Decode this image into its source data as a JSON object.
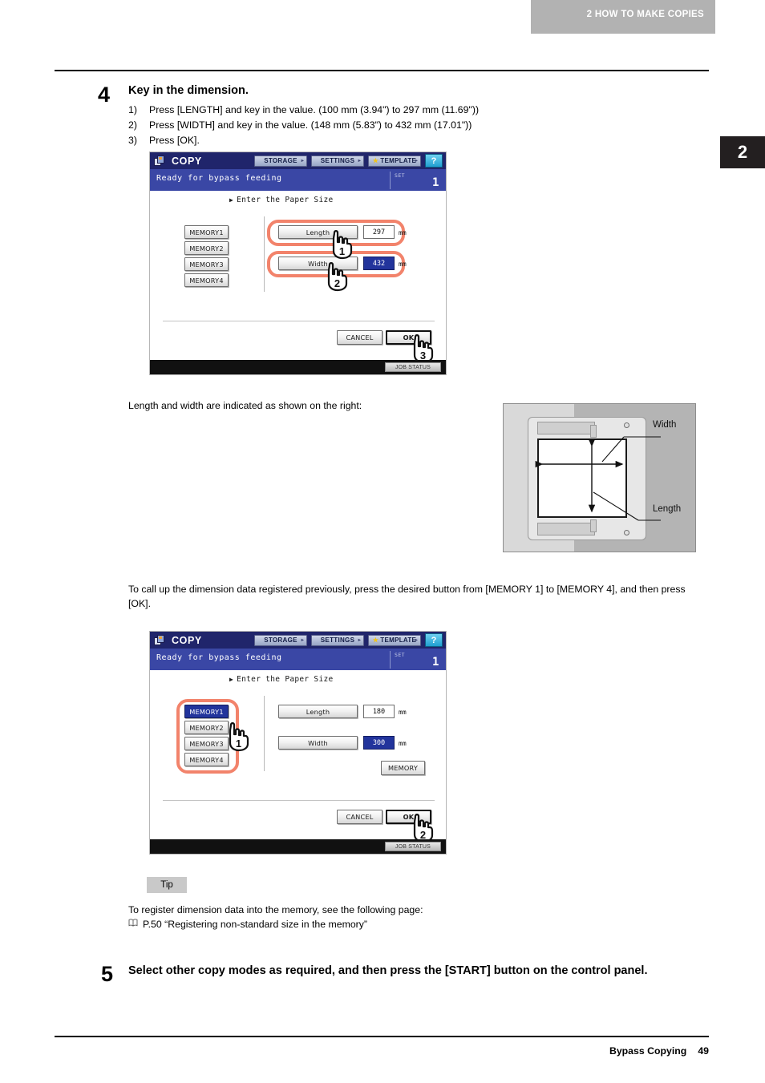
{
  "header": {
    "running_head": "2 HOW TO MAKE COPIES",
    "chapter_tab": "2"
  },
  "step4": {
    "number": "4",
    "title": "Key in the dimension.",
    "substeps": [
      {
        "marker": "1)",
        "text": "Press [LENGTH] and key in the value. (100 mm (3.94\") to 297 mm (11.69\"))"
      },
      {
        "marker": "2)",
        "text": "Press [WIDTH] and key in the value. (148 mm (5.83\") to 432 mm (17.01\"))"
      },
      {
        "marker": "3)",
        "text": "Press [OK]."
      }
    ]
  },
  "panel1": {
    "app_title": "COPY",
    "top_buttons": [
      {
        "label": "STORAGE",
        "has_star": false
      },
      {
        "label": "SETTINGS",
        "has_star": false
      },
      {
        "label": "TEMPLATE",
        "has_star": true
      }
    ],
    "help_label": "?",
    "status_message": "Ready for bypass feeding",
    "set_label": "SET",
    "set_value": "1",
    "prompt": "Enter the Paper Size",
    "memory_buttons": [
      "MEMORY1",
      "MEMORY2",
      "MEMORY3",
      "MEMORY4"
    ],
    "selected_memory": "",
    "fields": [
      {
        "label": "Length",
        "value": "297",
        "unit": "mm",
        "highlighted": false
      },
      {
        "label": "Width",
        "value": "432",
        "unit": "mm",
        "highlighted": true
      }
    ],
    "cancel_label": "CANCEL",
    "ok_label": "OK",
    "job_status_label": "JOB STATUS",
    "pointer_badges": [
      "1",
      "2",
      "3"
    ]
  },
  "caption1": "Length and width are indicated as shown on the right:",
  "illustration": {
    "width_label": "Width",
    "length_label": "Length"
  },
  "caption2": "To call up the dimension data registered previously, press the desired button from [MEMORY 1] to [MEMORY 4], and then press [OK].",
  "panel2": {
    "app_title": "COPY",
    "top_buttons": [
      {
        "label": "STORAGE",
        "has_star": false
      },
      {
        "label": "SETTINGS",
        "has_star": false
      },
      {
        "label": "TEMPLATE",
        "has_star": true
      }
    ],
    "help_label": "?",
    "status_message": "Ready for bypass feeding",
    "set_label": "SET",
    "set_value": "1",
    "prompt": "Enter the Paper Size",
    "memory_buttons": [
      "MEMORY1",
      "MEMORY2",
      "MEMORY3",
      "MEMORY4"
    ],
    "selected_memory": "MEMORY1",
    "fields": [
      {
        "label": "Length",
        "value": "180",
        "unit": "mm",
        "highlighted": false
      },
      {
        "label": "Width",
        "value": "300",
        "unit": "mm",
        "highlighted": true
      }
    ],
    "memory_save_label": "MEMORY",
    "cancel_label": "CANCEL",
    "ok_label": "OK",
    "job_status_label": "JOB STATUS",
    "pointer_badges": [
      "1",
      "2"
    ]
  },
  "tip": {
    "label": "Tip",
    "line1": "To register dimension data into the memory, see the following page:",
    "reference": "P.50 “Registering non-standard size in the memory”"
  },
  "step5": {
    "number": "5",
    "title": "Select other copy modes as required, and then press the [START] button on the control panel."
  },
  "footer": {
    "section": "Bypass Copying",
    "page": "49"
  },
  "colors": {
    "accent_ring": "#f2836b",
    "panel_titlebar": "#20256b",
    "panel_statusbar": "#3a47a5",
    "selected_blue": "#22349c",
    "header_gray": "#b2b2b2"
  }
}
